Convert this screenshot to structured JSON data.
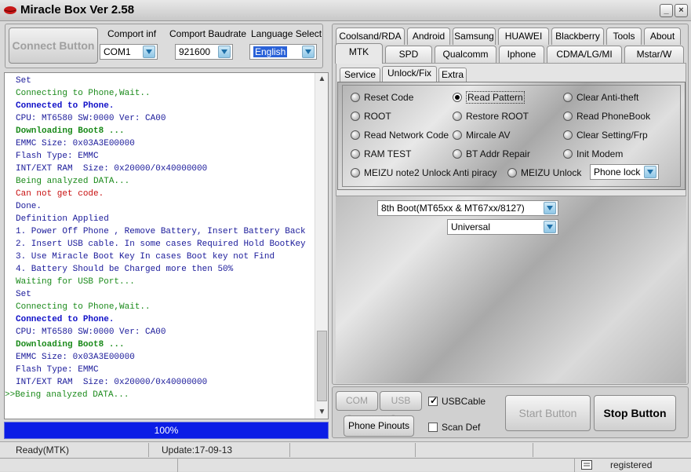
{
  "window": {
    "title": "Miracle Box Ver 2.58",
    "min_glyph": "_",
    "close_glyph": "×"
  },
  "connect": {
    "button_label": "Connect Button",
    "comport_label": "Comport inf",
    "comport_value": "COM1",
    "baud_label": "Comport Baudrate",
    "baud_value": "921600",
    "lang_label": "Language Select",
    "lang_value": "English"
  },
  "log": {
    "lines": [
      {
        "text": "Set",
        "color": "#1a1a9a"
      },
      {
        "text": "Connecting to Phone,Wait..",
        "color": "#1a8a1a"
      },
      {
        "text": "Connected to Phone.",
        "color": "#1010c8"
      },
      {
        "text": "CPU: MT6580 SW:0000 Ver: CA00",
        "color": "#1a1a9a"
      },
      {
        "text": "Downloading Boot8 ...",
        "color": "#1a8a1a"
      },
      {
        "text": "EMMC Size: 0x03A3E00000",
        "color": "#1a1a9a"
      },
      {
        "text": "Flash Type: EMMC",
        "color": "#1a1a9a"
      },
      {
        "text": "INT/EXT RAM  Size: 0x20000/0x40000000",
        "color": "#1a1a9a"
      },
      {
        "text": "Being analyzed DATA...",
        "color": "#1a8a1a"
      },
      {
        "text": "Can not get code.",
        "color": "#c81010"
      },
      {
        "text": "Done.",
        "color": "#1a1a9a"
      },
      {
        "text": "Definition Applied",
        "color": "#1a1a9a"
      },
      {
        "text": "1. Power Off Phone , Remove Battery, Insert Battery Back",
        "color": "#1a1a9a"
      },
      {
        "text": "2. Insert USB cable. In some cases Required Hold BootKey",
        "color": "#1a1a9a"
      },
      {
        "text": "3. Use Miracle Boot Key In cases Boot key not Find",
        "color": "#1a1a9a"
      },
      {
        "text": "4. Battery Should be Charged more then 50%",
        "color": "#1a1a9a"
      },
      {
        "text": "Waiting for USB Port...",
        "color": "#1a8a1a"
      },
      {
        "text": "Set",
        "color": "#1a1a9a"
      },
      {
        "text": "Connecting to Phone,Wait..",
        "color": "#1a8a1a"
      },
      {
        "text": "Connected to Phone.",
        "color": "#1010c8"
      },
      {
        "text": "CPU: MT6580 SW:0000 Ver: CA00",
        "color": "#1a1a9a"
      },
      {
        "text": "Downloading Boot8 ...",
        "color": "#1a8a1a"
      },
      {
        "text": "EMMC Size: 0x03A3E00000",
        "color": "#1a1a9a"
      },
      {
        "text": "Flash Type: EMMC",
        "color": "#1a1a9a"
      },
      {
        "text": "INT/EXT RAM  Size: 0x20000/0x40000000",
        "color": "#1a1a9a"
      },
      {
        "text": ">>Being analyzed DATA...",
        "color": "#1a8a1a"
      }
    ],
    "bold_texts": [
      "Connected to Phone.",
      "Downloading Boot8 ..."
    ],
    "scroll_up_glyph": "▲",
    "scroll_down_glyph": "▼"
  },
  "progress": {
    "value": 1.0,
    "label": "100%"
  },
  "tabs_top": [
    "Coolsand/RDA",
    "Android",
    "Samsung",
    "HUAWEI",
    "Blackberry",
    "Tools",
    "About"
  ],
  "tabs_bottom": [
    "MTK",
    "SPD",
    "Qualcomm",
    "Iphone",
    "CDMA/LG/MI",
    "Mstar/W"
  ],
  "active_tab": "MTK",
  "subtabs": [
    "Service",
    "Unlock/Fix",
    "Extra"
  ],
  "active_subtab": "Unlock/Fix",
  "options": [
    [
      "Reset Code",
      "Read Pattern",
      "Clear Anti-theft"
    ],
    [
      "ROOT",
      "Restore ROOT",
      "Read PhoneBook"
    ],
    [
      "Read Network Code",
      "Mircale AV",
      "Clear Setting/Frp"
    ],
    [
      "RAM TEST",
      "BT Addr Repair",
      "Init Modem"
    ]
  ],
  "selected_option": "Read Pattern",
  "meizu": {
    "opt1": "MEIZU note2  Unlock Anti piracy",
    "opt2": "MEIZU  Unlock",
    "combo_value": "Phone lock"
  },
  "boot_combo": "8th Boot(MT65xx & MT67xx/8127)",
  "universal_combo": "Universal",
  "bottom": {
    "com_scan": "COM Scan",
    "usb_scan": "USB Scan",
    "usb_cable": "USBCable",
    "usb_cable_checked": true,
    "phone_pinouts": "Phone Pinouts",
    "scan_def": "Scan Def",
    "scan_def_checked": false,
    "start_button": "Start Button",
    "stop_button": "Stop Button"
  },
  "status": {
    "ready": "Ready(MTK)",
    "update": "Update:17-09-13",
    "registered": "registered"
  },
  "icons": {
    "app": "lips-icon",
    "keyboard": "keyboard-icon"
  }
}
